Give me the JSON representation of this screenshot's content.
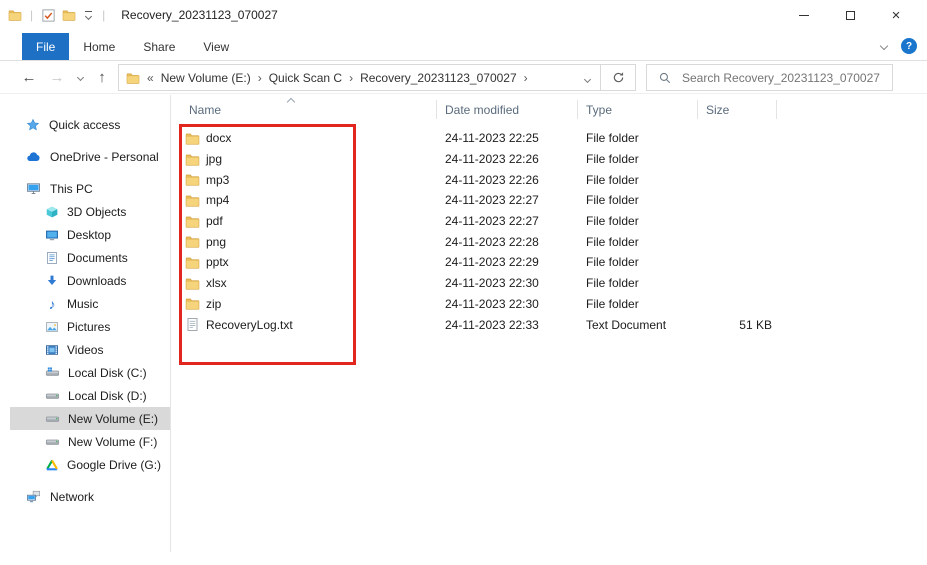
{
  "window": {
    "title": "Recovery_20231123_070027"
  },
  "icons": {
    "back": "←",
    "forward": "→",
    "up": "↑",
    "close": "×",
    "help": "?",
    "music_note": "♪",
    "qat_separator": "|",
    "title_separator": "|"
  },
  "ribbon": {
    "tabs": [
      "File",
      "Home",
      "Share",
      "View"
    ]
  },
  "breadcrumb": {
    "overflow": "«",
    "separator": "›",
    "crumbs": [
      "New Volume (E:)",
      "Quick Scan C",
      "Recovery_20231123_070027"
    ]
  },
  "search": {
    "placeholder": "Search Recovery_20231123_070027"
  },
  "sidebar": {
    "items": [
      {
        "label": "Quick access"
      },
      {
        "label": "OneDrive - Personal"
      },
      {
        "label": "This PC"
      },
      {
        "label": "3D Objects"
      },
      {
        "label": "Desktop"
      },
      {
        "label": "Documents"
      },
      {
        "label": "Downloads"
      },
      {
        "label": "Music"
      },
      {
        "label": "Pictures"
      },
      {
        "label": "Videos"
      },
      {
        "label": "Local Disk (C:)"
      },
      {
        "label": "Local Disk (D:)"
      },
      {
        "label": "New Volume (E:)"
      },
      {
        "label": "New Volume (F:)"
      },
      {
        "label": "Google Drive (G:)"
      },
      {
        "label": "Network"
      }
    ]
  },
  "list": {
    "columns": [
      "Name",
      "Date modified",
      "Type",
      "Size"
    ],
    "rows": [
      {
        "name": "docx",
        "date": "24-11-2023 22:25",
        "type": "File folder",
        "size": ""
      },
      {
        "name": "jpg",
        "date": "24-11-2023 22:26",
        "type": "File folder",
        "size": ""
      },
      {
        "name": "mp3",
        "date": "24-11-2023 22:26",
        "type": "File folder",
        "size": ""
      },
      {
        "name": "mp4",
        "date": "24-11-2023 22:27",
        "type": "File folder",
        "size": ""
      },
      {
        "name": "pdf",
        "date": "24-11-2023 22:27",
        "type": "File folder",
        "size": ""
      },
      {
        "name": "png",
        "date": "24-11-2023 22:28",
        "type": "File folder",
        "size": ""
      },
      {
        "name": "pptx",
        "date": "24-11-2023 22:29",
        "type": "File folder",
        "size": ""
      },
      {
        "name": "xlsx",
        "date": "24-11-2023 22:30",
        "type": "File folder",
        "size": ""
      },
      {
        "name": "zip",
        "date": "24-11-2023 22:30",
        "type": "File folder",
        "size": ""
      },
      {
        "name": "RecoveryLog.txt",
        "date": "24-11-2023 22:33",
        "type": "Text Document",
        "size": "51 KB"
      }
    ]
  },
  "colors": {
    "accent_blue": "#1d70c4",
    "annotation_red": "#e2261f",
    "selected_gray": "#d9d9d9",
    "folder_yellow": "#f6d47c"
  }
}
